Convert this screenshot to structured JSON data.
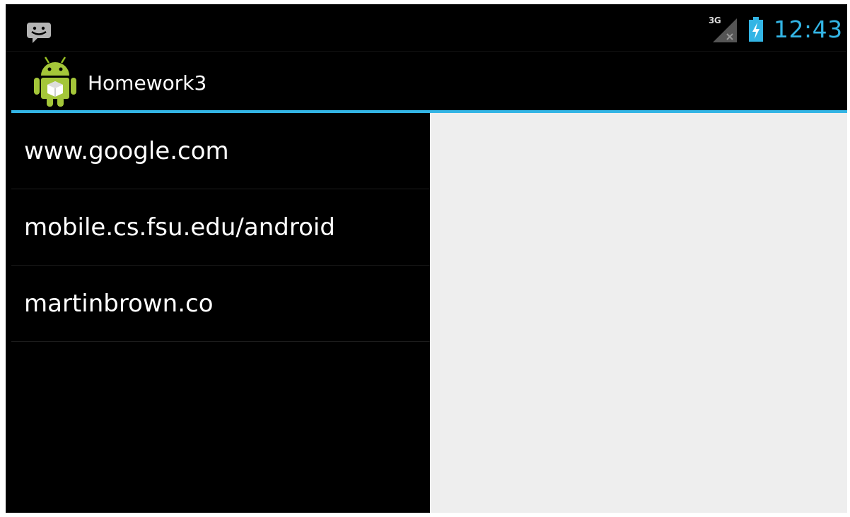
{
  "status_bar": {
    "notification_icon": "chat-notification-icon",
    "network_type": "3G",
    "signal_icon": "signal-no-data-icon",
    "battery_icon": "battery-charging-icon",
    "time": "12:43",
    "accent_color": "#33b5e5"
  },
  "action_bar": {
    "app_icon": "android-app-icon",
    "title": "Homework3"
  },
  "list": {
    "items": [
      {
        "label": "www.google.com"
      },
      {
        "label": "mobile.cs.fsu.edu/android"
      },
      {
        "label": "martinbrown.co"
      }
    ]
  },
  "colors": {
    "background": "#000000",
    "accent": "#33b5e5",
    "detail_pane": "#eeeeee"
  }
}
